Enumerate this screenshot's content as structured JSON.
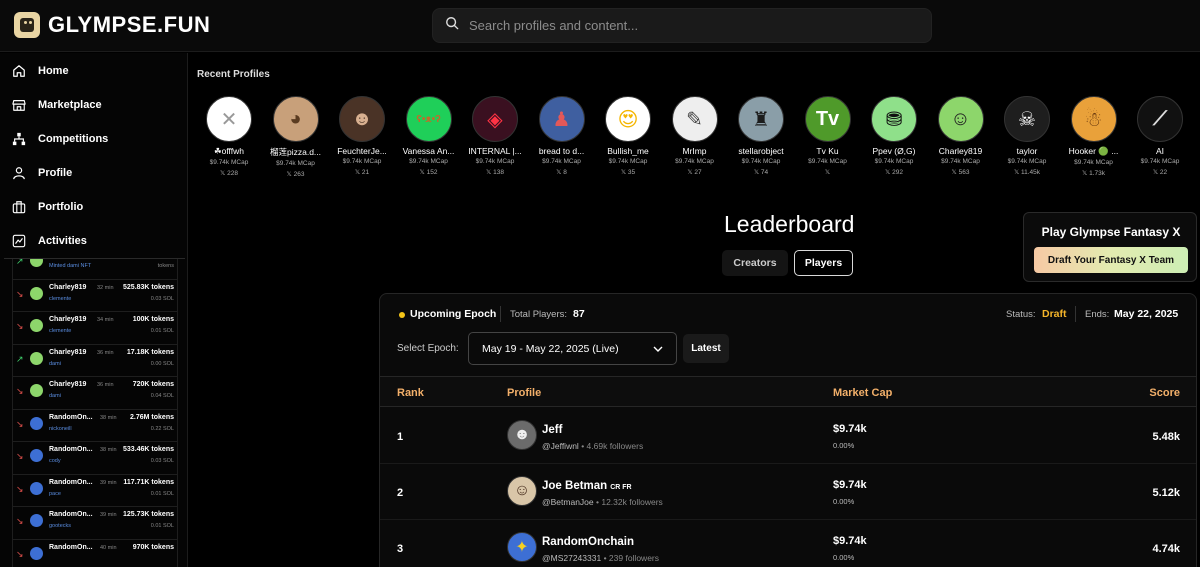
{
  "brand": {
    "name": "GLYMPSE.FUN"
  },
  "search": {
    "placeholder": "Search profiles and content..."
  },
  "sidebar": {
    "nav": [
      {
        "label": "Home",
        "icon": "home-icon"
      },
      {
        "label": "Marketplace",
        "icon": "store-icon"
      },
      {
        "label": "Competitions",
        "icon": "competitions-icon"
      },
      {
        "label": "Profile",
        "icon": "user-icon"
      },
      {
        "label": "Portfolio",
        "icon": "briefcase-icon"
      },
      {
        "label": "Activities",
        "icon": "activity-chart-icon"
      }
    ],
    "activity": [
      {
        "name": "Charley819",
        "time": "",
        "sub": "Minted dami NFT",
        "tokens": "...",
        "sol": "tokens",
        "dir": "up",
        "color": "#8dd66b"
      },
      {
        "name": "Charley819",
        "time": "32 min",
        "sub": "clemente",
        "tokens": "525.83K tokens",
        "sol": "0.03 SOL",
        "dir": "down",
        "color": "#8dd66b"
      },
      {
        "name": "Charley819",
        "time": "34 min",
        "sub": "clemente",
        "tokens": "100K tokens",
        "sol": "0.01 SOL",
        "dir": "down",
        "color": "#8dd66b"
      },
      {
        "name": "Charley819",
        "time": "36 min",
        "sub": "dami",
        "tokens": "17.18K tokens",
        "sol": "0.00 SOL",
        "dir": "up",
        "color": "#8dd66b"
      },
      {
        "name": "Charley819",
        "time": "36 min",
        "sub": "dami",
        "tokens": "720K tokens",
        "sol": "0.04 SOL",
        "dir": "down",
        "color": "#8dd66b"
      },
      {
        "name": "RandomOn...",
        "time": "38 min",
        "sub": "nickoneill",
        "tokens": "2.76M tokens",
        "sol": "0.22 SOL",
        "dir": "down",
        "color": "#3d6fd4"
      },
      {
        "name": "RandomOn...",
        "time": "38 min",
        "sub": "cody",
        "tokens": "533.46K tokens",
        "sol": "0.03 SOL",
        "dir": "down",
        "color": "#3d6fd4"
      },
      {
        "name": "RandomOn...",
        "time": "39 min",
        "sub": "pace",
        "tokens": "117.71K tokens",
        "sol": "0.01 SOL",
        "dir": "down",
        "color": "#3d6fd4"
      },
      {
        "name": "RandomOn...",
        "time": "39 min",
        "sub": "gootecks",
        "tokens": "125.73K tokens",
        "sol": "0.01 SOL",
        "dir": "down",
        "color": "#3d6fd4"
      },
      {
        "name": "RandomOn...",
        "time": "40 min",
        "sub": "",
        "tokens": "970K tokens",
        "sol": "",
        "dir": "down",
        "color": "#3d6fd4"
      }
    ]
  },
  "recent": {
    "title": "Recent Profiles",
    "profiles": [
      {
        "name": "☘offfwh",
        "mcap": "$9.74k MCap",
        "followers": "228",
        "bg": "#ffffff",
        "fg": "#999",
        "glyph": "✕"
      },
      {
        "name": "榴莲pizza.d...",
        "mcap": "$9.74k MCap",
        "followers": "263",
        "bg": "#c8a07a",
        "fg": "#5a3b20",
        "glyph": "◕"
      },
      {
        "name": "FeuchterJe...",
        "mcap": "$9.74k MCap",
        "followers": "21",
        "bg": "#4a3326",
        "fg": "#d8b090",
        "glyph": "☻"
      },
      {
        "name": "Vanessa An...",
        "mcap": "$9.74k MCap",
        "followers": "152",
        "bg": "#1fcf59",
        "fg": "#c46a2a",
        "glyph": "ʕ•ᴥ•ʔ"
      },
      {
        "name": "INTERNAL |...",
        "mcap": "$9.74k MCap",
        "followers": "138",
        "bg": "#3a1020",
        "fg": "#ff3344",
        "glyph": "◈"
      },
      {
        "name": "bread to d...",
        "mcap": "$9.74k MCap",
        "followers": "8",
        "bg": "#3f5fa0",
        "fg": "#e35858",
        "glyph": "♟"
      },
      {
        "name": "Bullish_me",
        "mcap": "$9.74k MCap",
        "followers": "35",
        "bg": "#ffffff",
        "fg": "#f5b600",
        "glyph": "😍"
      },
      {
        "name": "MrImp",
        "mcap": "$9.74k MCap",
        "followers": "27",
        "bg": "#eeeeee",
        "fg": "#444",
        "glyph": "✎"
      },
      {
        "name": "stellarobject",
        "mcap": "$9.74k MCap",
        "followers": "74",
        "bg": "#8a9ea8",
        "fg": "#1c1c1c",
        "glyph": "♜"
      },
      {
        "name": "Tv Ku",
        "mcap": "$9.74k MCap",
        "followers": "",
        "bg": "#4f9a2a",
        "fg": "#ffffff",
        "glyph": "Tv"
      },
      {
        "name": "Ppev (Ø,G)",
        "mcap": "$9.74k MCap",
        "followers": "292",
        "bg": "#8fe08a",
        "fg": "#111",
        "glyph": "⛃"
      },
      {
        "name": "Charley819",
        "mcap": "$9.74k MCap",
        "followers": "563",
        "bg": "#8dd66b",
        "fg": "#222",
        "glyph": "☺"
      },
      {
        "name": "taylor",
        "mcap": "$9.74k MCap",
        "followers": "11.45k",
        "bg": "#1e1e1e",
        "fg": "#fff",
        "glyph": "☠"
      },
      {
        "name": "Hooker 🟢 ...",
        "mcap": "$9.74k MCap",
        "followers": "1.73k",
        "bg": "#e9a13a",
        "fg": "#6a3a10",
        "glyph": "☃"
      },
      {
        "name": "AI",
        "mcap": "$9.74k MCap",
        "followers": "22",
        "bg": "#111111",
        "fg": "#ddd",
        "glyph": "⟋"
      }
    ]
  },
  "leaderboard": {
    "title": "Leaderboard",
    "tabs": {
      "creators": "Creators",
      "players": "Players"
    },
    "epoch_label": "Upcoming Epoch",
    "total_label": "Total Players:",
    "total_value": "87",
    "status_label": "Status:",
    "status_value": "Draft",
    "ends_label": "Ends:",
    "ends_value": "May 22, 2025",
    "select_label": "Select Epoch:",
    "select_value": "May 19 - May 22, 2025 (Live)",
    "latest_label": "Latest",
    "columns": {
      "rank": "Rank",
      "profile": "Profile",
      "mcap": "Market Cap",
      "score": "Score"
    },
    "rows": [
      {
        "rank": "1",
        "name": "Jeff",
        "tag": "",
        "handle": "@Jeffiwnl",
        "followers": "• 4.69k followers",
        "mcap": "$9.74k",
        "pct": "0.00%",
        "score": "5.48k",
        "bg": "#6b6b6b",
        "fg": "#eee",
        "glyph": "☻"
      },
      {
        "rank": "2",
        "name": "Joe Betman",
        "tag": "CR FR",
        "handle": "@BetmanJoe",
        "followers": "• 12.32k followers",
        "mcap": "$9.74k",
        "pct": "0.00%",
        "score": "5.12k",
        "bg": "#d9c6a8",
        "fg": "#4a3020",
        "glyph": "☺"
      },
      {
        "rank": "3",
        "name": "RandomOnchain",
        "tag": "",
        "handle": "@MS27243331",
        "followers": "• 239 followers",
        "mcap": "$9.74k",
        "pct": "0.00%",
        "score": "4.74k",
        "bg": "#3d6fd4",
        "fg": "#f5d020",
        "glyph": "✦"
      }
    ]
  },
  "fantasy": {
    "title": "Play Glympse Fantasy X",
    "button": "Draft Your Fantasy X Team"
  }
}
